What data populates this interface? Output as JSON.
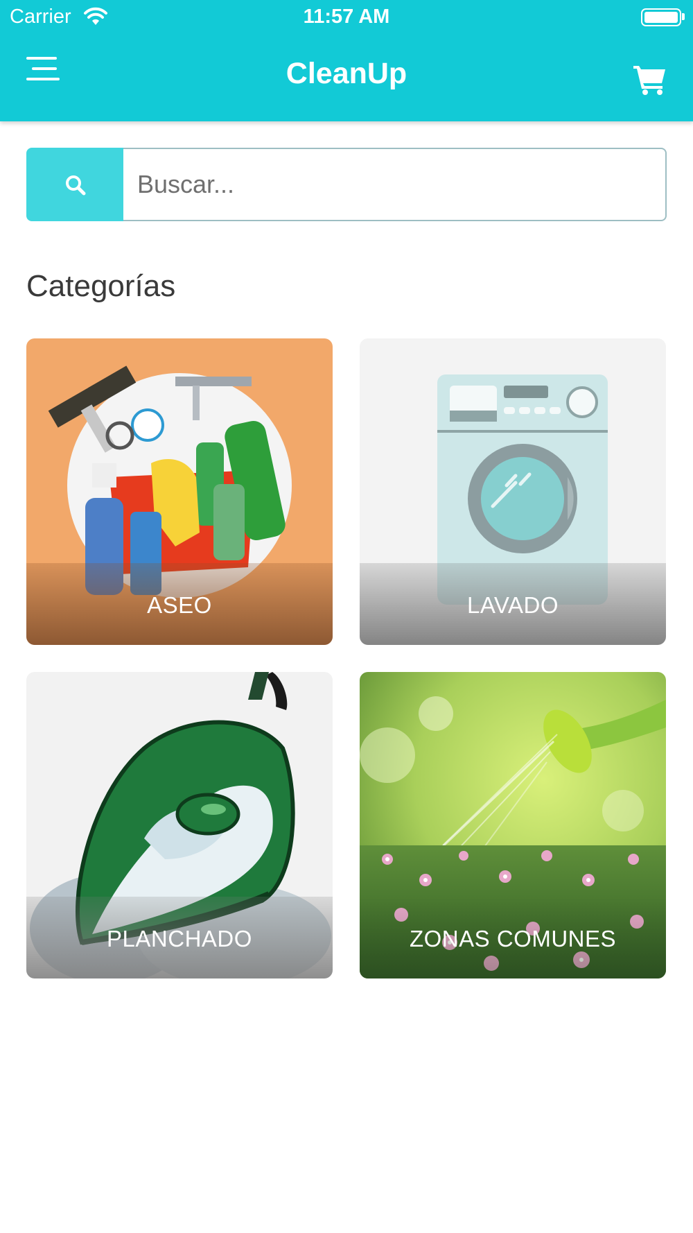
{
  "status_bar": {
    "carrier": "Carrier",
    "time": "11:57 AM"
  },
  "header": {
    "title": "CleanUp",
    "background_color": "#12CAD6",
    "menu_icon": "hamburger-menu-icon",
    "cart_icon": "shopping-cart-icon"
  },
  "search": {
    "placeholder": "Buscar...",
    "value": "",
    "icon": "search-icon",
    "button_color": "#40D6DE"
  },
  "categories": {
    "title": "Categorías",
    "items": [
      {
        "label": "ASEO"
      },
      {
        "label": "LAVADO"
      },
      {
        "label": "PLANCHADO"
      },
      {
        "label": "ZONAS COMUNES"
      }
    ]
  }
}
